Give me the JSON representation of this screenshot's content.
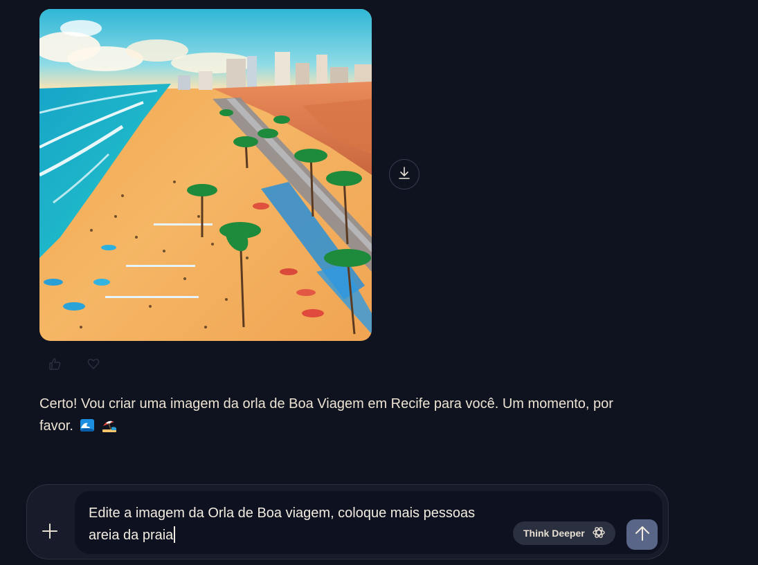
{
  "generated_image": {
    "alt_name": "beach-orla-image"
  },
  "actions": {
    "download_icon": "download-icon",
    "like_icon": "thumbs-up-icon",
    "dislike_icon": "heart-icon"
  },
  "assistant_message": {
    "text": "Certo! Vou criar uma imagem da orla de Boa Viagem em Recife para você. Um momento, por favor.",
    "emojis": [
      "wave-emoji",
      "beach-umbrella-emoji"
    ]
  },
  "composer": {
    "input_value": "Edite a imagem da Orla de Boa viagem, coloque mais pessoas areia da praia",
    "think_label": "Think Deeper",
    "plus_icon": "plus-icon",
    "send_icon": "arrow-up-icon"
  },
  "colors": {
    "background": "#0f1320",
    "composer_bg": "#171b2a",
    "send_button": "#5a6688",
    "think_button": "#2a3040"
  }
}
